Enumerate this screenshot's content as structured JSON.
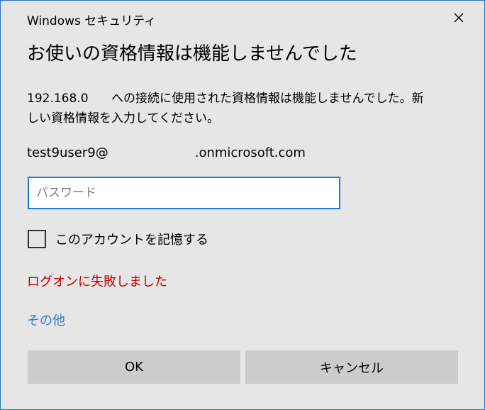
{
  "window": {
    "title": "Windows セキュリティ",
    "close_icon": "close-icon"
  },
  "dialog": {
    "heading": "お使いの資格情報は機能しませんでした",
    "message": {
      "ip": "192.168.0",
      "line1_rest": "への接続に使用された資格情報は機能しませんでした。新",
      "line2": "しい資格情報を入力してください。"
    },
    "account": {
      "user_part": "test9user9@",
      "domain_part": ".onmicrosoft.com"
    },
    "password": {
      "value": "",
      "placeholder": "パスワード"
    },
    "remember": {
      "label": "このアカウントを記憶する",
      "checked": false
    },
    "error_text": "ログオンに失敗しました",
    "more_link": "その他",
    "buttons": {
      "ok": "OK",
      "cancel": "キャンセル"
    }
  },
  "colors": {
    "background": "#e6e6e6",
    "border": "#1e73be",
    "input_border": "#1c7cd6",
    "error": "#c00000",
    "link": "#2c7fc6",
    "button": "#cccccc"
  }
}
